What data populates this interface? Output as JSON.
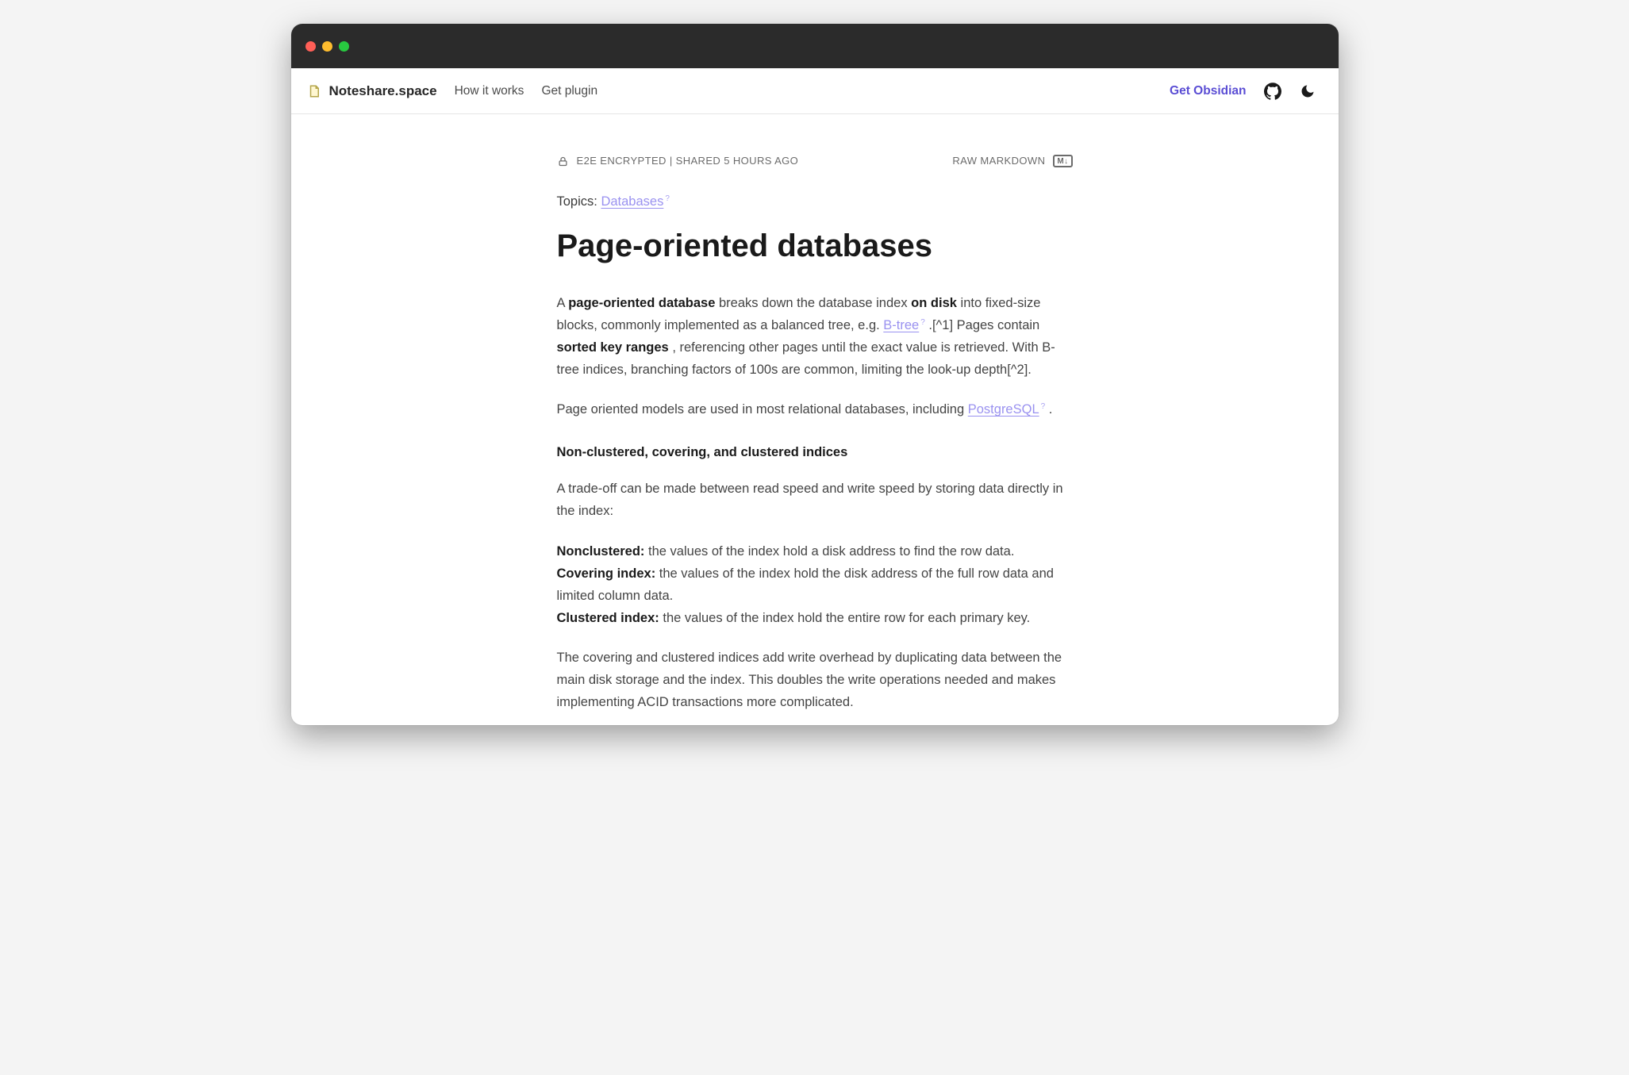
{
  "nav": {
    "brand": "Noteshare.space",
    "how_it_works": "How it works",
    "get_plugin": "Get plugin",
    "get_obsidian": "Get Obsidian"
  },
  "meta": {
    "encrypted_shared": "E2E ENCRYPTED | SHARED 5 HOURS AGO",
    "raw_markdown": "RAW MARKDOWN",
    "md_badge": "M↓"
  },
  "topics": {
    "label": "Topics: ",
    "link": "Databases"
  },
  "title": "Page-oriented databases",
  "para1": {
    "t1": "A ",
    "b1": "page-oriented database",
    "t2": " breaks down the database index ",
    "b2": "on disk",
    "t3": " into fixed-size blocks, commonly implemented as a balanced tree, e.g. ",
    "link": "B-tree",
    "t4": ".[^1] Pages contain ",
    "b3": "sorted key ranges",
    "t5": ", referencing other pages until the exact value is retrieved. With B-tree indices, branching factors of 100s are common, limiting the look-up depth[^2]."
  },
  "para2": {
    "t1": "Page oriented models are used in most relational databases, including ",
    "link": "PostgreSQL",
    "t2": "."
  },
  "section_head": "Non-clustered, covering, and clustered indices",
  "para3": "A trade-off can be made between read speed and write speed by storing data directly in the index:",
  "defs": {
    "nc_label": "Nonclustered:",
    "nc_text": " the values of the index hold a disk address to find the row data.",
    "cov_label": "Covering index:",
    "cov_text": " the values of the index hold the disk address of the full row data and limited column data.",
    "cl_label": "Clustered index:",
    "cl_text": " the values of the index hold the entire row for each primary key."
  },
  "para4": "The covering and clustered indices add write overhead by duplicating data between the main disk storage and the index. This doubles the write operations needed and makes implementing ACID transactions more complicated."
}
